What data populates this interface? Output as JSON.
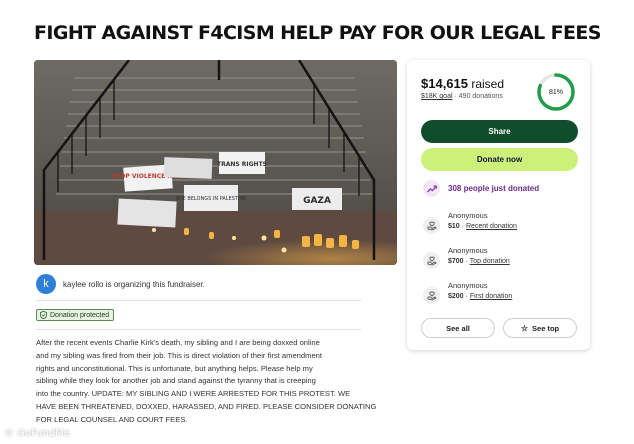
{
  "page": {
    "title": "FIGHT AGAINST F4CISM HELP PAY FOR OUR LEGAL FEES"
  },
  "photo": {
    "signs": [
      "STOP VIOLENCE NOW",
      "TRANS RIGHTS",
      "GAZA",
      "SHE BELONGS IN PALESTINE"
    ]
  },
  "organizer": {
    "avatar_letter": "k",
    "text": "kaylee rollo is organizing this fundraiser."
  },
  "badge": {
    "label": "Donation protected"
  },
  "story": {
    "lines": [
      "After the recent events Charlie Kirk's death, my sibling and I are being doxxed online",
      "and my sibling was fired from their job. This is direct violation of their first amendment",
      "rights and unconstitutional. This is unfortunate, but anything helps. Please help my",
      "sibling while they look for another job and stand against the tyranny that is creeping",
      "into the country. UPDATE: MY SIBLING AND I WERE ARRESTED FOR THIS PROTEST. WE",
      "HAVE BEEN THREATENED, DOXXED, HARASSED, AND FIRED. PLEASE CONSIDER DONATING",
      "FOR LEGAL COUNSEL AND COURT FEES."
    ]
  },
  "card": {
    "amount": "$14,615",
    "raised_label": "raised",
    "goal": "$18K goal",
    "separator": "·",
    "donations": "490 donations",
    "progress_label": "81%",
    "progress": 0.81,
    "share_label": "Share",
    "donate_label": "Donate now",
    "trend_text": "308 people just donated",
    "donations_list": [
      {
        "name": "Anonymous",
        "amount": "$10",
        "sep": "·",
        "tag": "Recent donation"
      },
      {
        "name": "Anonymous",
        "amount": "$700",
        "sep": "·",
        "tag": "Top donation"
      },
      {
        "name": "Anonymous",
        "amount": "$200",
        "sep": "·",
        "tag": "First donation"
      }
    ],
    "see_all_label": "See all",
    "see_top_label": "See top"
  },
  "colors": {
    "share_button": "#114d2a",
    "donate_button": "#cdf07a",
    "progress": "#1f9d48",
    "trend": "#6b2a8a"
  },
  "watermark": {
    "text": "© GoFundMe"
  }
}
